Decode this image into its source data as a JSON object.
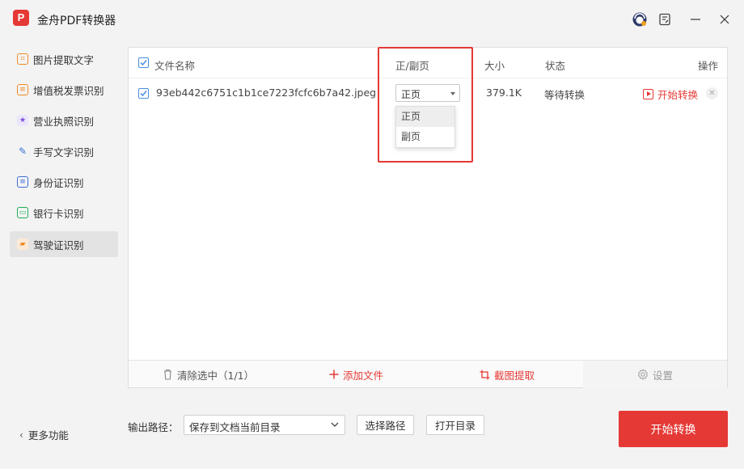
{
  "app": {
    "logo_text": "P",
    "title": "金舟PDF转换器"
  },
  "window_controls": [
    "support-icon",
    "feedback-icon",
    "minimize-icon",
    "close-icon"
  ],
  "sidebar": {
    "items": [
      {
        "label": "图片提取文字",
        "icon": "image-text-icon",
        "color": "#f08a24"
      },
      {
        "label": "增值税发票识别",
        "icon": "invoice-icon",
        "color": "#f08a24"
      },
      {
        "label": "营业执照识别",
        "icon": "license-icon",
        "color": "#7b4bd6"
      },
      {
        "label": "手写文字识别",
        "icon": "pen-icon",
        "color": "#3b6fd8"
      },
      {
        "label": "身份证识别",
        "icon": "id-card-icon",
        "color": "#3b6fd8"
      },
      {
        "label": "银行卡识别",
        "icon": "bank-card-icon",
        "color": "#1fae5a"
      },
      {
        "label": "驾驶证识别",
        "icon": "car-icon",
        "color": "#f08a24",
        "active": true
      }
    ],
    "more": "更多功能"
  },
  "table": {
    "headers": {
      "name": "文件名称",
      "side": "正/副页",
      "size": "大小",
      "status": "状态",
      "action": "操作"
    },
    "rows": [
      {
        "checked": true,
        "name": "93eb442c6751c1b1ce7223fcfc6b7a42.jpeg",
        "side": "正页",
        "size": "379.1K",
        "status": "等待转换",
        "action": "开始转换"
      }
    ],
    "side_options": [
      "正页",
      "副页"
    ]
  },
  "toolbar": {
    "clear": "清除选中（1/1）",
    "add": "添加文件",
    "crop": "截图提取",
    "settings": "设置"
  },
  "output": {
    "label": "输出路径：",
    "path": "保存到文档当前目录",
    "choose": "选择路径",
    "open": "打开目录",
    "start": "开始转换"
  },
  "colors": {
    "accent": "#e53935",
    "checkbox": "#4a90e2"
  }
}
